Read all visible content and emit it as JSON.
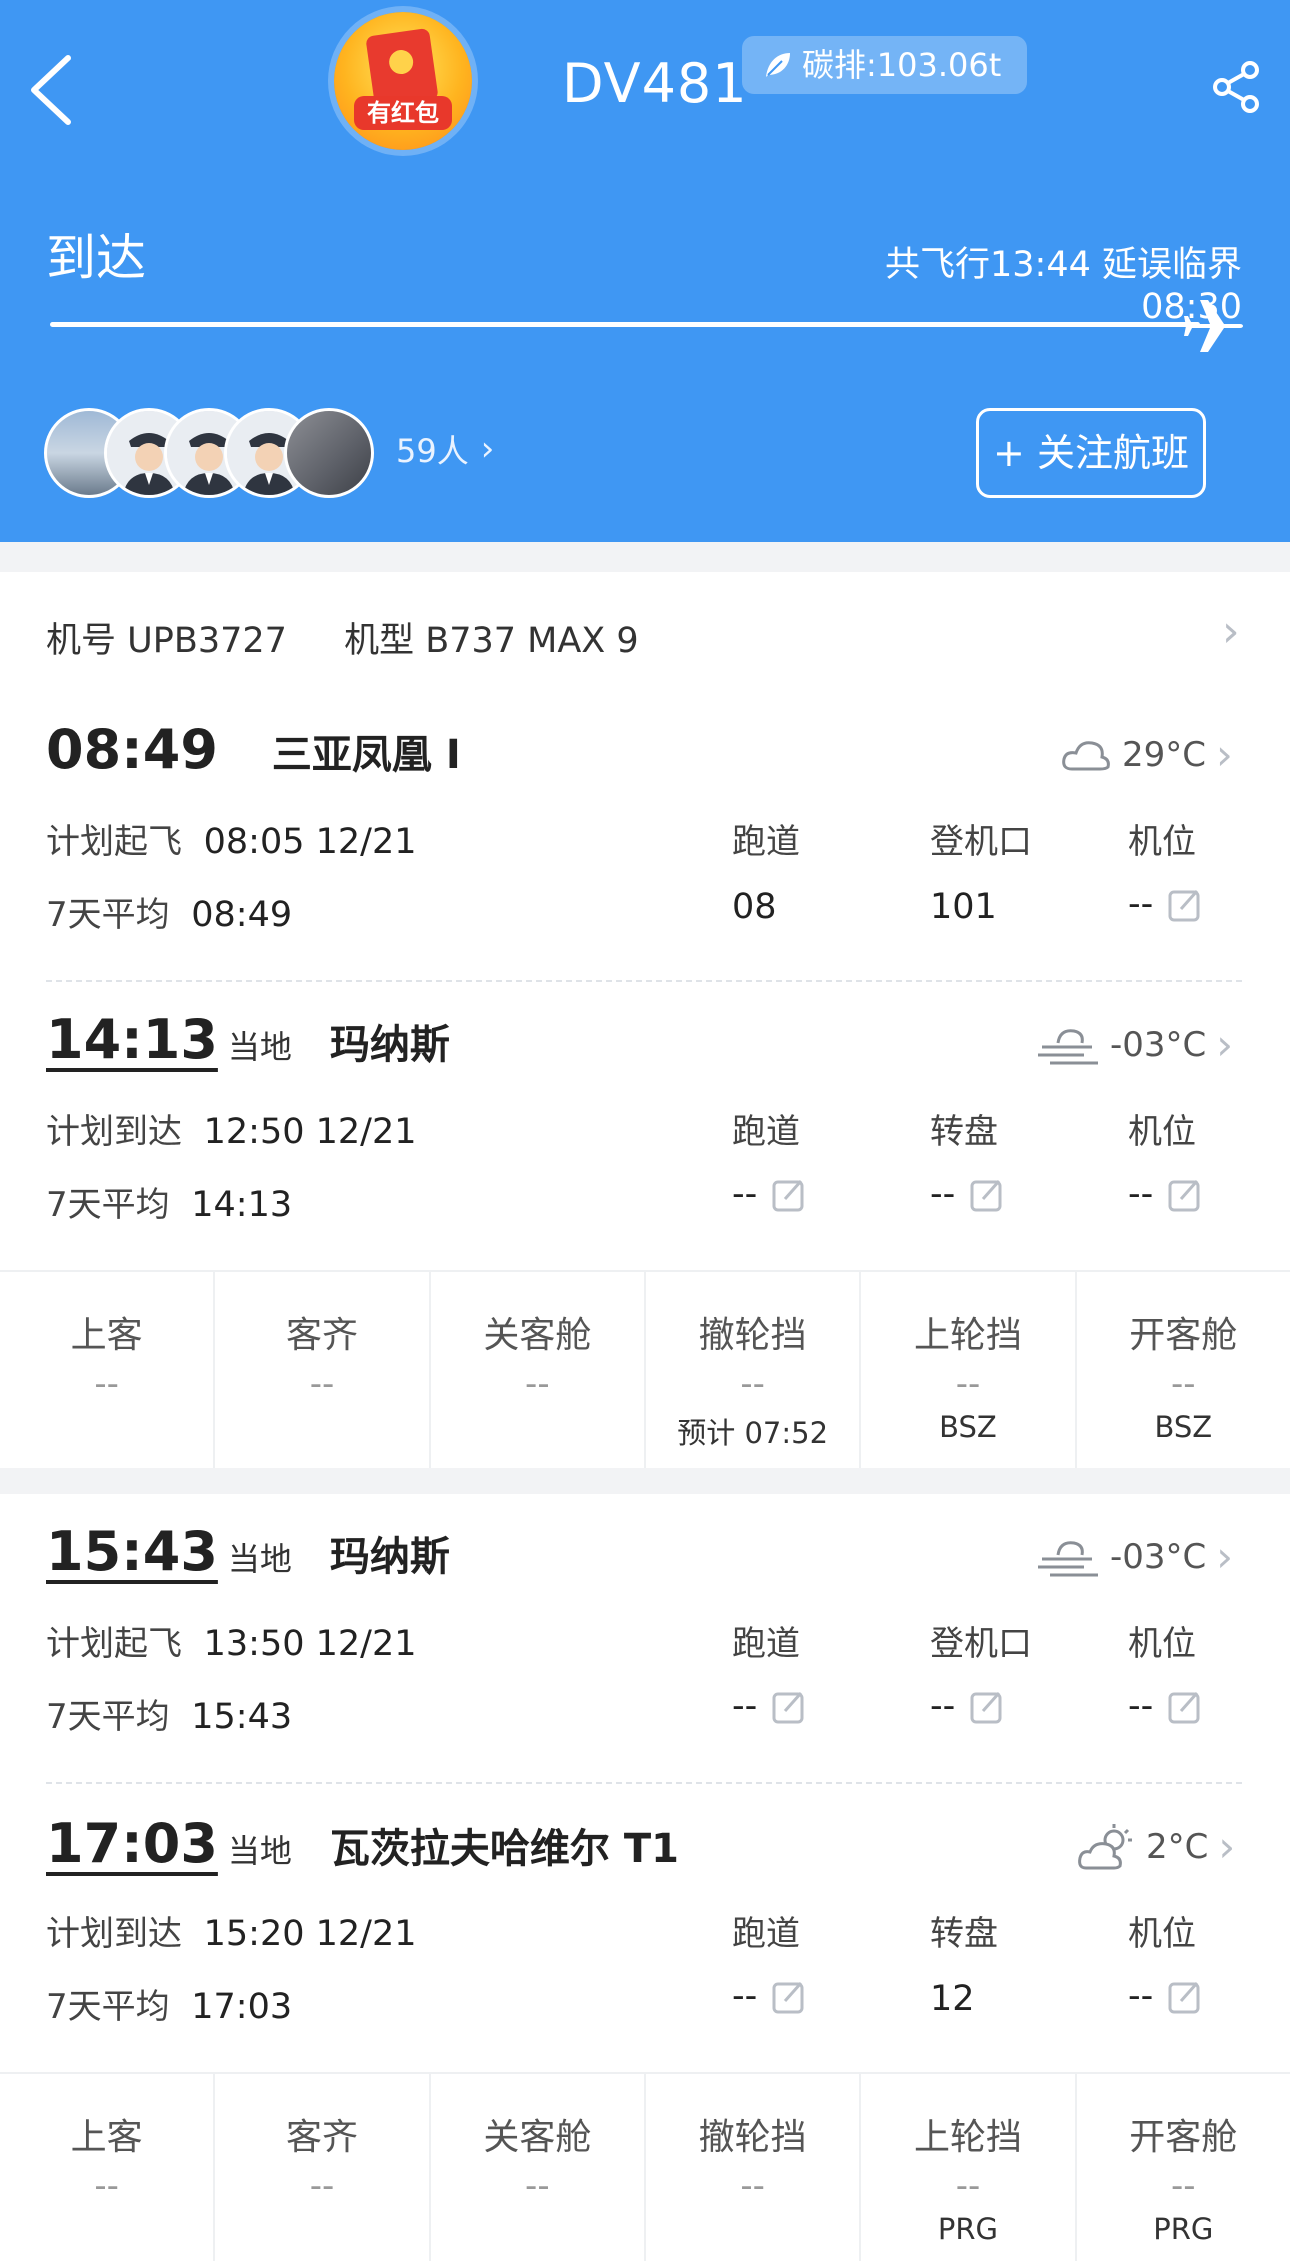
{
  "header": {
    "red_packet_label": "有红包",
    "flight_no": "DV481",
    "carbon": "碳排:103.06t",
    "status": "到达",
    "flight_info": "共飞行13:44 延误临界 08:30",
    "followers_count": "59人",
    "follow_button": "+ 关注航班",
    "accent_color": "#3f97f3",
    "avatar_count": 5
  },
  "aircraft": {
    "reg": "机号 UPB3727",
    "type": "机型 B737 MAX 9"
  },
  "leg1": {
    "dep": {
      "time": "08:49",
      "airport": "三亚凤凰 I",
      "weather_icon": "cloud-icon",
      "temp": "29°C",
      "plan_label": "计划起飞",
      "plan_value": "08:05 12/21",
      "avg_label": "7天平均",
      "avg_value": "08:49",
      "cols": [
        {
          "label": "跑道",
          "value": "08"
        },
        {
          "label": "登机口",
          "value": "101"
        },
        {
          "label": "机位",
          "value": "--"
        }
      ]
    },
    "arr": {
      "time": "14:13",
      "local": "当地",
      "airport": "玛纳斯",
      "weather_icon": "fog-icon",
      "temp": "-03°C",
      "plan_label": "计划到达",
      "plan_value": "12:50 12/21",
      "avg_label": "7天平均",
      "avg_value": "14:13",
      "cols": [
        {
          "label": "跑道",
          "value": "--"
        },
        {
          "label": "转盘",
          "value": "--"
        },
        {
          "label": "机位",
          "value": "--"
        }
      ]
    },
    "grid": [
      {
        "title": "上客",
        "value": "--",
        "sub": ""
      },
      {
        "title": "客齐",
        "value": "--",
        "sub": ""
      },
      {
        "title": "关客舱",
        "value": "--",
        "sub": ""
      },
      {
        "title": "撤轮挡",
        "value": "--",
        "sub": "预计 07:52"
      },
      {
        "title": "上轮挡",
        "value": "--",
        "sub": "BSZ"
      },
      {
        "title": "开客舱",
        "value": "--",
        "sub": "BSZ"
      }
    ]
  },
  "leg2": {
    "dep": {
      "time": "15:43",
      "local": "当地",
      "airport": "玛纳斯",
      "weather_icon": "fog-icon",
      "temp": "-03°C",
      "plan_label": "计划起飞",
      "plan_value": "13:50 12/21",
      "avg_label": "7天平均",
      "avg_value": "15:43",
      "cols": [
        {
          "label": "跑道",
          "value": "--"
        },
        {
          "label": "登机口",
          "value": "--"
        },
        {
          "label": "机位",
          "value": "--"
        }
      ]
    },
    "arr": {
      "time": "17:03",
      "local": "当地",
      "airport": "瓦茨拉夫哈维尔 T1",
      "weather_icon": "partly-cloudy-icon",
      "temp": "2°C",
      "plan_label": "计划到达",
      "plan_value": "15:20 12/21",
      "avg_label": "7天平均",
      "avg_value": "17:03",
      "cols": [
        {
          "label": "跑道",
          "value": "--"
        },
        {
          "label": "转盘",
          "value": "12"
        },
        {
          "label": "机位",
          "value": "--"
        }
      ]
    },
    "grid": [
      {
        "title": "上客",
        "value": "--",
        "sub": ""
      },
      {
        "title": "客齐",
        "value": "--",
        "sub": ""
      },
      {
        "title": "关客舱",
        "value": "--",
        "sub": ""
      },
      {
        "title": "撤轮挡",
        "value": "--",
        "sub": ""
      },
      {
        "title": "上轮挡",
        "value": "--",
        "sub": "PRG"
      },
      {
        "title": "开客舱",
        "value": "--",
        "sub": "PRG"
      }
    ]
  }
}
